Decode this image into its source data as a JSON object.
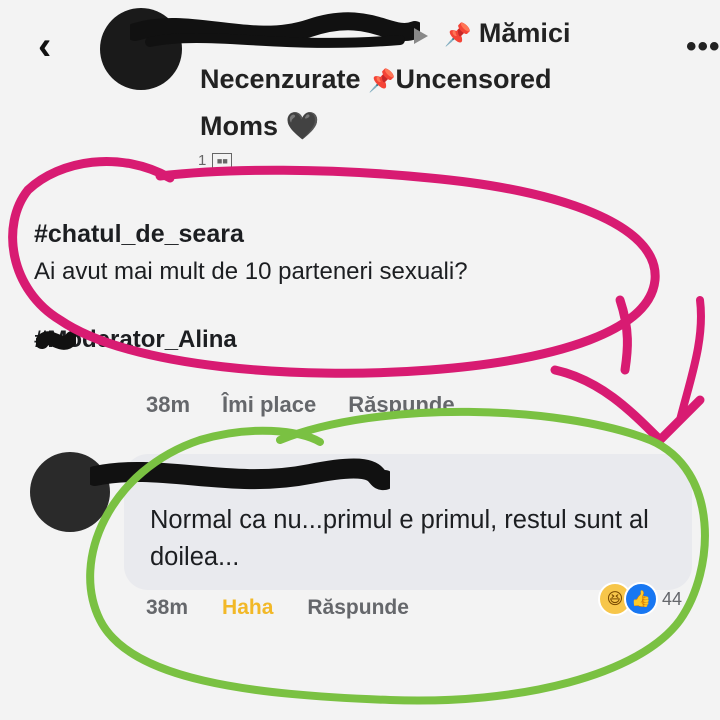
{
  "header": {
    "back_icon": "chevron-left-icon",
    "group_line_1": "Mămici",
    "group_line_2_a": "Necenzurate",
    "group_line_2_b": "Uncensored",
    "group_line_3": "Moms",
    "heart": "🖤",
    "pin_icon": "📌",
    "more_label": "•••",
    "meta_text": "1"
  },
  "post": {
    "hashtag": "#chatul_de_seara",
    "question": "Ai avut mai mult de 10 parteneri sexuali?",
    "moderator": "#Moderator_Alina",
    "time": "38m",
    "like_label": "Îmi place",
    "reply_label": "Răspunde"
  },
  "comment": {
    "text": "Normal ca nu...primul e primul, restul sunt al doilea...",
    "time": "38m",
    "reaction_label": "Haha",
    "reply_label": "Răspunde",
    "reaction_count": "44",
    "haha_icon": "😆",
    "like_icon": "👍"
  },
  "colors": {
    "annotation_pink": "#d81b72",
    "annotation_green": "#7ac142",
    "haha_yellow": "#f2b827",
    "like_blue": "#1877f2"
  }
}
